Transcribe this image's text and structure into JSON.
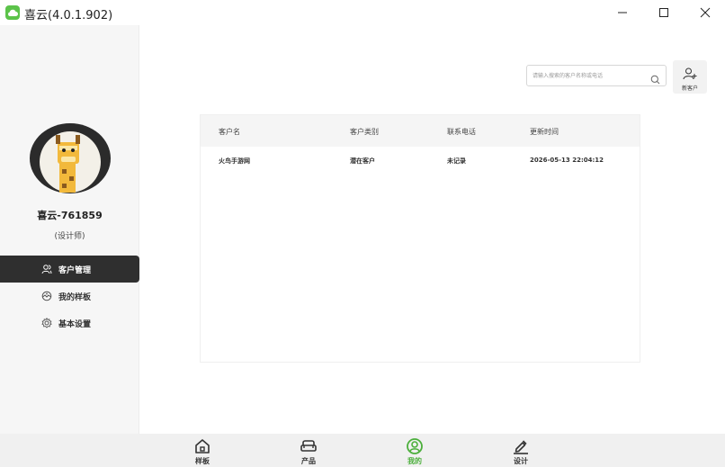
{
  "window": {
    "title": "喜云(4.0.1.902)",
    "accent_color": "#5cc34a"
  },
  "sidebar": {
    "user_name": "喜云-761859",
    "user_role": "(设计师)",
    "items": [
      {
        "label": "客户管理",
        "icon": "users-icon",
        "active": true
      },
      {
        "label": "我的样板",
        "icon": "template-icon",
        "active": false
      },
      {
        "label": "基本设置",
        "icon": "gear-icon",
        "active": false
      }
    ]
  },
  "search": {
    "placeholder": "请输入搜索的客户名称或电话"
  },
  "toolbar": {
    "new_client_label": "新客户"
  },
  "table": {
    "columns": [
      "客户名",
      "客户类别",
      "联系电话",
      "更新时间"
    ],
    "rows": [
      [
        "火鸟手游网",
        "潜在客户",
        "未记录",
        "2026-05-13 22:04:12"
      ]
    ]
  },
  "tabs": [
    {
      "label": "样板",
      "icon": "home-icon",
      "active": false
    },
    {
      "label": "产品",
      "icon": "sofa-icon",
      "active": false
    },
    {
      "label": "我的",
      "icon": "user-circle-icon",
      "active": true
    },
    {
      "label": "设计",
      "icon": "pen-icon",
      "active": false
    }
  ],
  "colors": {
    "active_tab": "#4caf3c",
    "sidebar_active_bg": "#2f2f2f"
  }
}
